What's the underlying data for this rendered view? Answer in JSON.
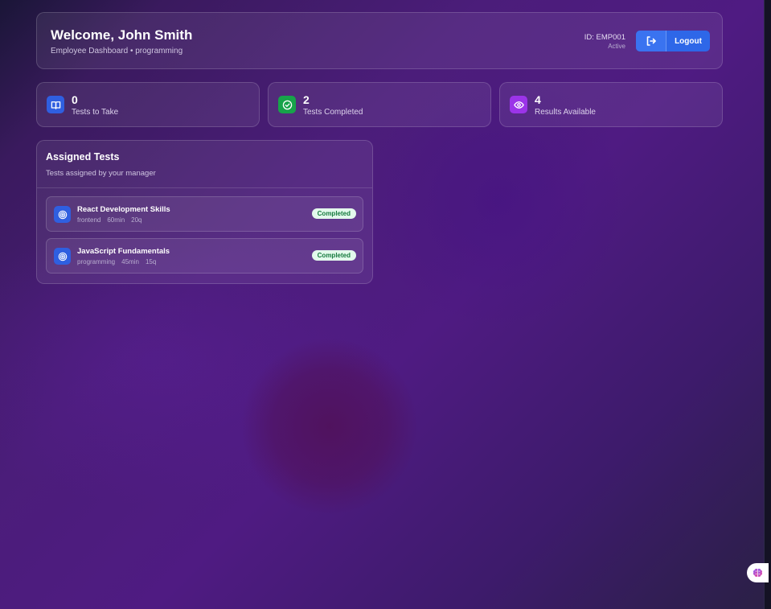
{
  "header": {
    "welcome": "Welcome, John Smith",
    "subtitle": "Employee Dashboard • programming",
    "employee_id": "ID: EMP001",
    "status": "Active",
    "logout_label": "Logout"
  },
  "stats": [
    {
      "value": "0",
      "label": "Tests to Take",
      "icon": "book-open-icon",
      "color": "#2f5fe0"
    },
    {
      "value": "2",
      "label": "Tests Completed",
      "icon": "check-circle-icon",
      "color": "#17a34a"
    },
    {
      "value": "4",
      "label": "Results Available",
      "icon": "eye-icon",
      "color": "#9b34e8"
    }
  ],
  "assigned": {
    "title": "Assigned Tests",
    "subtitle": "Tests assigned by your manager",
    "tests": [
      {
        "title": "React Development Skills",
        "category": "frontend",
        "duration": "60min",
        "questions": "20q",
        "status": "Completed"
      },
      {
        "title": "JavaScript Fundamentals",
        "category": "programming",
        "duration": "45min",
        "questions": "15q",
        "status": "Completed"
      }
    ]
  },
  "colors": {
    "accent": "#2e67e8",
    "completed_bg": "#e3f9ec",
    "completed_text": "#157a3d"
  }
}
